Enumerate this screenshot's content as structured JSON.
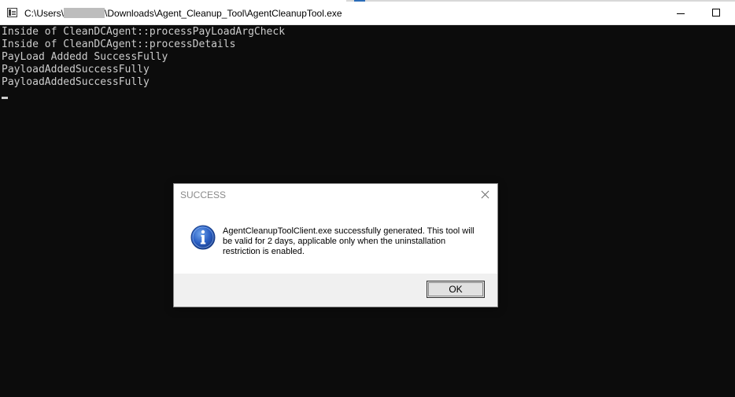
{
  "window": {
    "title_prefix": "C:\\Users\\",
    "title_suffix": "\\Downloads\\Agent_Cleanup_Tool\\AgentCleanupTool.exe"
  },
  "console": {
    "lines": [
      "Inside of CleanDCAgent::processPayLoadArgCheck",
      "Inside of CleanDCAgent::processDetails",
      "PayLoad Addedd SuccessFully",
      "PayloadAddedSuccessFully",
      "PayloadAddedSuccessFully"
    ],
    "background_color": "#0c0c0c",
    "text_color": "#cccccc"
  },
  "dialog": {
    "title": "SUCCESS",
    "message": "AgentCleanupToolClient.exe successfully generated. This tool will be valid for 2 days, applicable only when the uninstallation restriction is enabled.",
    "icon": "information-icon",
    "ok_label": "OK"
  }
}
